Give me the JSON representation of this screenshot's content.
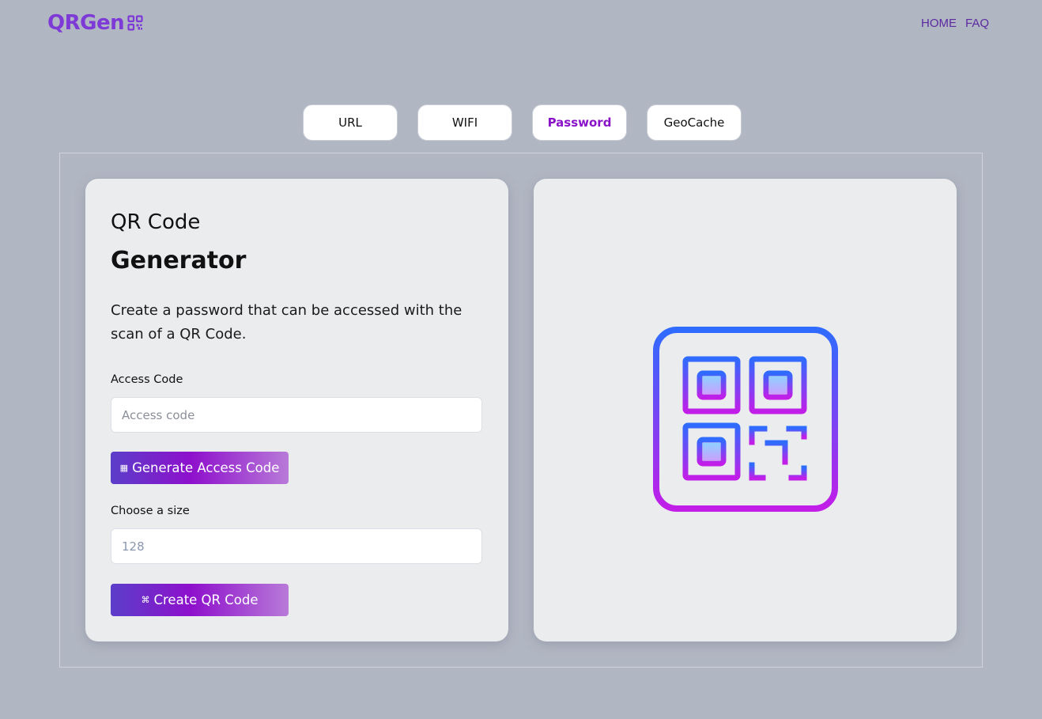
{
  "header": {
    "logo_text": "QRGen",
    "nav": [
      {
        "label": "HOME"
      },
      {
        "label": "FAQ"
      }
    ]
  },
  "tabs": [
    {
      "label": "URL",
      "active": false
    },
    {
      "label": "WIFI",
      "active": false
    },
    {
      "label": "Password",
      "active": true
    },
    {
      "label": "GeoCache",
      "active": false
    }
  ],
  "form": {
    "title_light": "QR Code",
    "title_bold": "Generator",
    "description": "Create a password that can be accessed with the scan of a QR Code.",
    "access_code": {
      "label": "Access Code",
      "placeholder": "Access code",
      "value": ""
    },
    "generate_button": {
      "icon": "qr-icon",
      "label": "Generate Access Code"
    },
    "size": {
      "label": "Choose a size",
      "placeholder": "128",
      "value": ""
    },
    "create_button": {
      "icon": "qr-icon",
      "label": "Create QR Code"
    }
  },
  "preview": {
    "icon": "qr-code-illustration-icon"
  },
  "colors": {
    "background": "#b1b6c3",
    "brand": "#7e3ad6",
    "active_tab": "#8a12c9",
    "gradient_start": "#2f6bff",
    "gradient_end": "#c11ee8"
  }
}
